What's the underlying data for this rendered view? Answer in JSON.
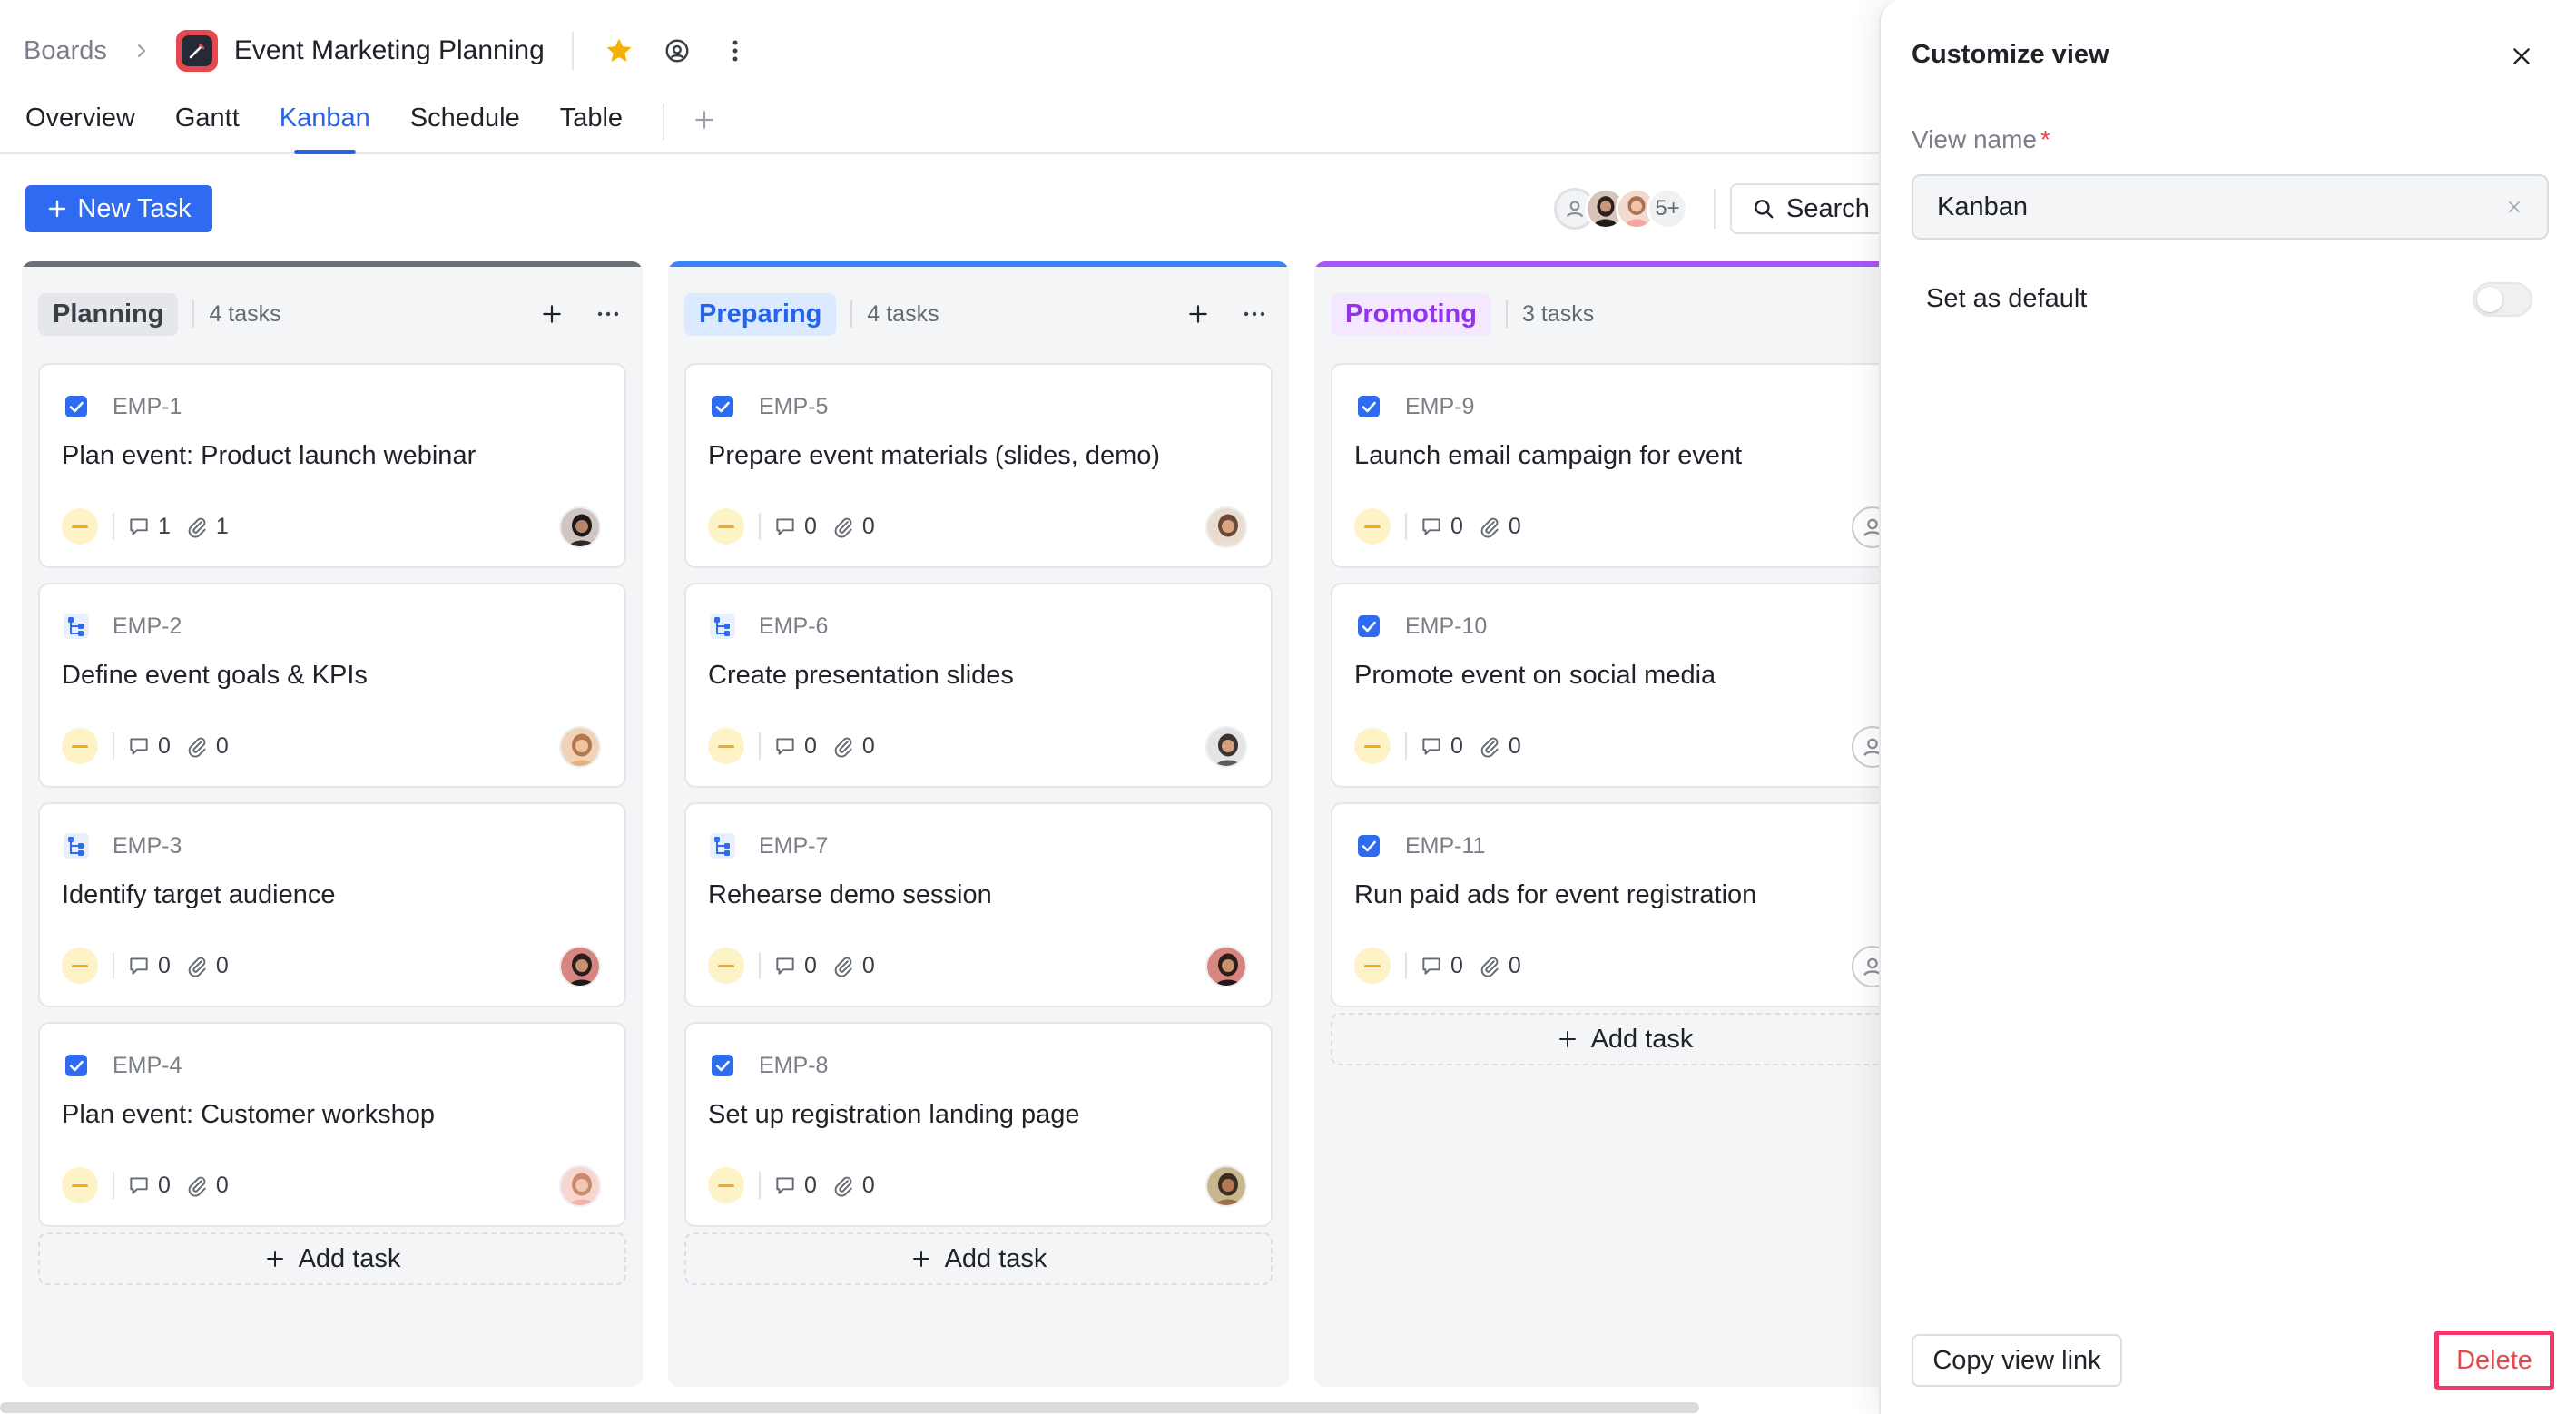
{
  "breadcrumb": {
    "root": "Boards",
    "board_title": "Event Marketing Planning"
  },
  "tabs": [
    "Overview",
    "Gantt",
    "Kanban",
    "Schedule",
    "Table"
  ],
  "active_tab": "Kanban",
  "toolbar": {
    "new_task": "New Task",
    "members_more": "5+",
    "search": "Search"
  },
  "columns": [
    {
      "name": "Planning",
      "count": "4 tasks",
      "accent": "#6b6f76",
      "chip_bg": "#e6e7ea",
      "chip_color": "#3a3f47",
      "add_task": "Add task",
      "cards": [
        {
          "id": "EMP-1",
          "title": "Plan event: Product launch webinar",
          "type": "task",
          "comments": "1",
          "attachments": "1",
          "avatar": "person-dark"
        },
        {
          "id": "EMP-2",
          "title": "Define event goals & KPIs",
          "type": "subtask",
          "comments": "0",
          "attachments": "0",
          "avatar": "person-warm"
        },
        {
          "id": "EMP-3",
          "title": "Identify target audience",
          "type": "subtask",
          "comments": "0",
          "attachments": "0",
          "avatar": "person-red"
        },
        {
          "id": "EMP-4",
          "title": "Plan event: Customer workshop",
          "type": "task",
          "comments": "0",
          "attachments": "0",
          "avatar": "person-pink"
        }
      ]
    },
    {
      "name": "Preparing",
      "count": "4 tasks",
      "accent": "#3b82f6",
      "chip_bg": "#dbeafe",
      "chip_color": "#2563eb",
      "add_task": "Add task",
      "cards": [
        {
          "id": "EMP-5",
          "title": "Prepare event materials (slides, demo)",
          "type": "task",
          "comments": "0",
          "attachments": "0",
          "avatar": "person-tan"
        },
        {
          "id": "EMP-6",
          "title": "Create presentation slides",
          "type": "subtask",
          "comments": "0",
          "attachments": "0",
          "avatar": "person-grey"
        },
        {
          "id": "EMP-7",
          "title": "Rehearse demo session",
          "type": "subtask",
          "comments": "0",
          "attachments": "0",
          "avatar": "person-red"
        },
        {
          "id": "EMP-8",
          "title": "Set up registration landing page",
          "type": "task",
          "comments": "0",
          "attachments": "0",
          "avatar": "person-olive"
        }
      ]
    },
    {
      "name": "Promoting",
      "count": "3 tasks",
      "accent": "#a855f7",
      "chip_bg": "#f3e8ff",
      "chip_color": "#9333ea",
      "add_task": "Add task",
      "cards": [
        {
          "id": "EMP-9",
          "title": "Launch email campaign for event",
          "type": "task",
          "comments": "0",
          "attachments": "0",
          "avatar": "unassigned"
        },
        {
          "id": "EMP-10",
          "title": "Promote event on social media",
          "type": "task",
          "comments": "0",
          "attachments": "0",
          "avatar": "unassigned"
        },
        {
          "id": "EMP-11",
          "title": "Run paid ads for event registration",
          "type": "task",
          "comments": "0",
          "attachments": "0",
          "avatar": "unassigned"
        }
      ]
    }
  ],
  "panel": {
    "title": "Customize view",
    "view_name_label": "View name",
    "required_mark": "*",
    "view_name_value": "Kanban",
    "set_default_label": "Set as default",
    "set_default_on": false,
    "copy_link": "Copy view link",
    "delete": "Delete"
  },
  "colors": {
    "primary": "#2f6bf0",
    "priority_medium": "#f5a623",
    "delete": "#e5484d"
  }
}
